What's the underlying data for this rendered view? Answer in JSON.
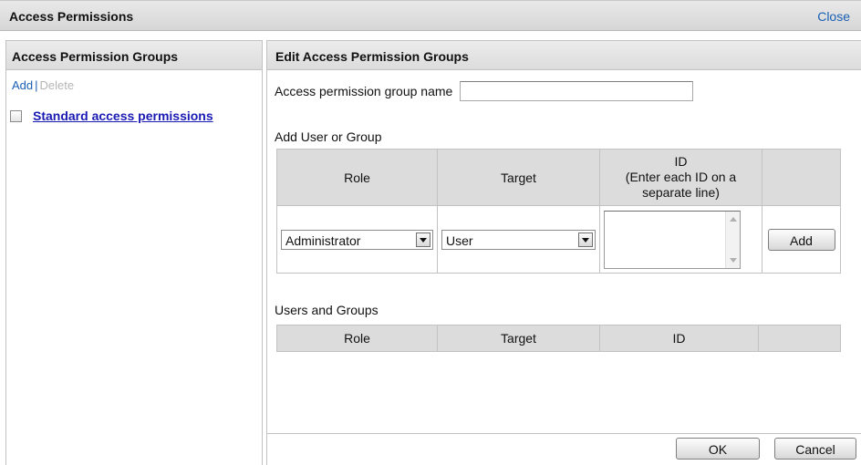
{
  "window": {
    "title": "Access Permissions",
    "close_label": "Close"
  },
  "left": {
    "header": "Access Permission Groups",
    "add_label": "Add",
    "separator": "|",
    "delete_label": "Delete",
    "groups": [
      {
        "label": "Standard access permissions",
        "checked": false
      }
    ]
  },
  "right": {
    "header": "Edit Access Permission Groups",
    "name_label": "Access permission group name",
    "name_value": "",
    "add_section_label": "Add User or Group",
    "add_table": {
      "col_role": "Role",
      "col_target": "Target",
      "col_id_line1": "ID",
      "col_id_line2": "(Enter each ID on a",
      "col_id_line3": "separate line)",
      "role_value": "Administrator",
      "target_value": "User",
      "id_value": "",
      "add_button": "Add"
    },
    "users_section_label": "Users and Groups",
    "users_table": {
      "col_role": "Role",
      "col_target": "Target",
      "col_id": "ID"
    },
    "ok_button": "OK",
    "cancel_button": "Cancel"
  }
}
